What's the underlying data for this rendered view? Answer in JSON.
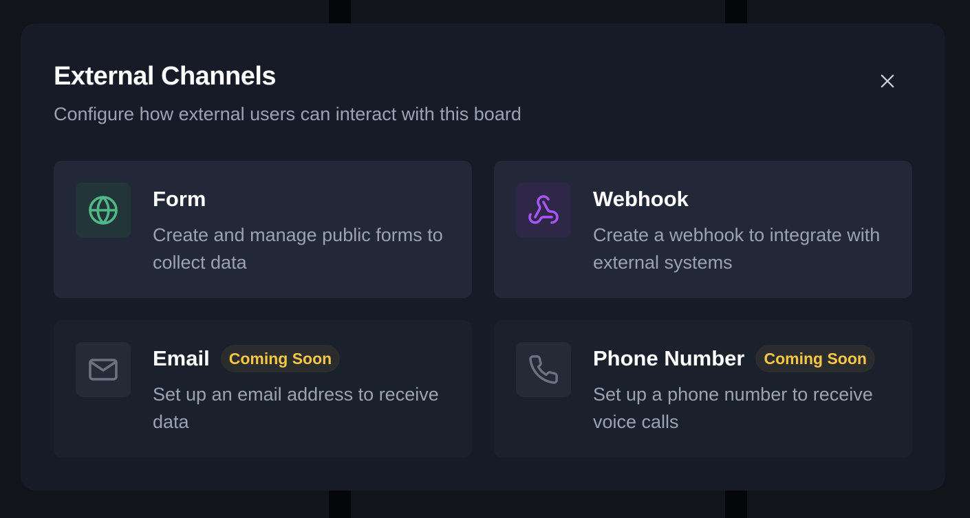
{
  "modal": {
    "title": "External Channels",
    "subtitle": "Configure how external users can interact with this board",
    "close_icon": "close-icon"
  },
  "channels": [
    {
      "title": "Form",
      "description": "Create and manage public forms to collect data",
      "icon": "globe-icon",
      "accent": "#4fb987",
      "badge": ""
    },
    {
      "title": "Webhook",
      "description": "Create a webhook to integrate with external systems",
      "icon": "webhook-icon",
      "accent": "#a855f7",
      "badge": ""
    },
    {
      "title": "Email",
      "description": "Set up an email address to receive data",
      "icon": "mail-icon",
      "accent": "#6b7280",
      "badge": "Coming Soon"
    },
    {
      "title": "Phone Number",
      "description": "Set up a phone number to receive voice calls",
      "icon": "phone-icon",
      "accent": "#6b7280",
      "badge": "Coming Soon"
    }
  ]
}
